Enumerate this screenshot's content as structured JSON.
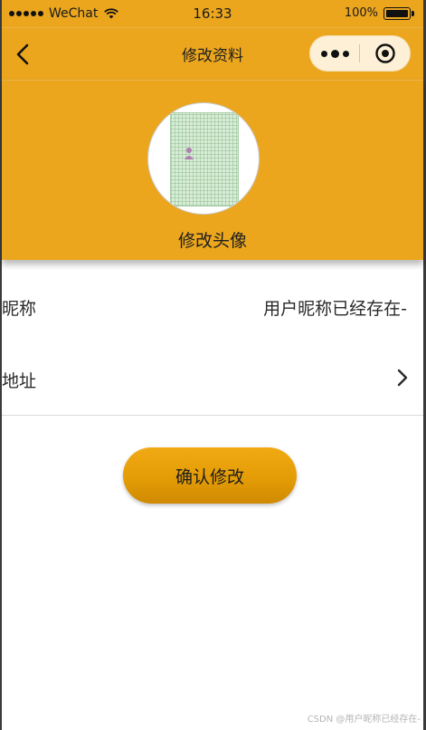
{
  "status_bar": {
    "carrier": "WeChat",
    "time": "16:33",
    "battery": "100%"
  },
  "nav": {
    "title": "修改资料",
    "back_icon": "chevron-left-icon",
    "more_icon": "more-dots-icon",
    "close_icon": "target-close-icon"
  },
  "profile": {
    "avatar_label": "修改头像"
  },
  "form": {
    "nickname_label": "昵称",
    "nickname_value": "用户昵称已经存在-",
    "address_label": "地址",
    "address_icon": "chevron-right-icon"
  },
  "actions": {
    "confirm_label": "确认修改"
  },
  "watermark": "CSDN @用户昵称已经存在-",
  "colors": {
    "header_bg": "#eba61e",
    "capsule_bg": "#fdf0d6",
    "button_bg": "#e29a05",
    "page_bg": "#ffffff"
  }
}
